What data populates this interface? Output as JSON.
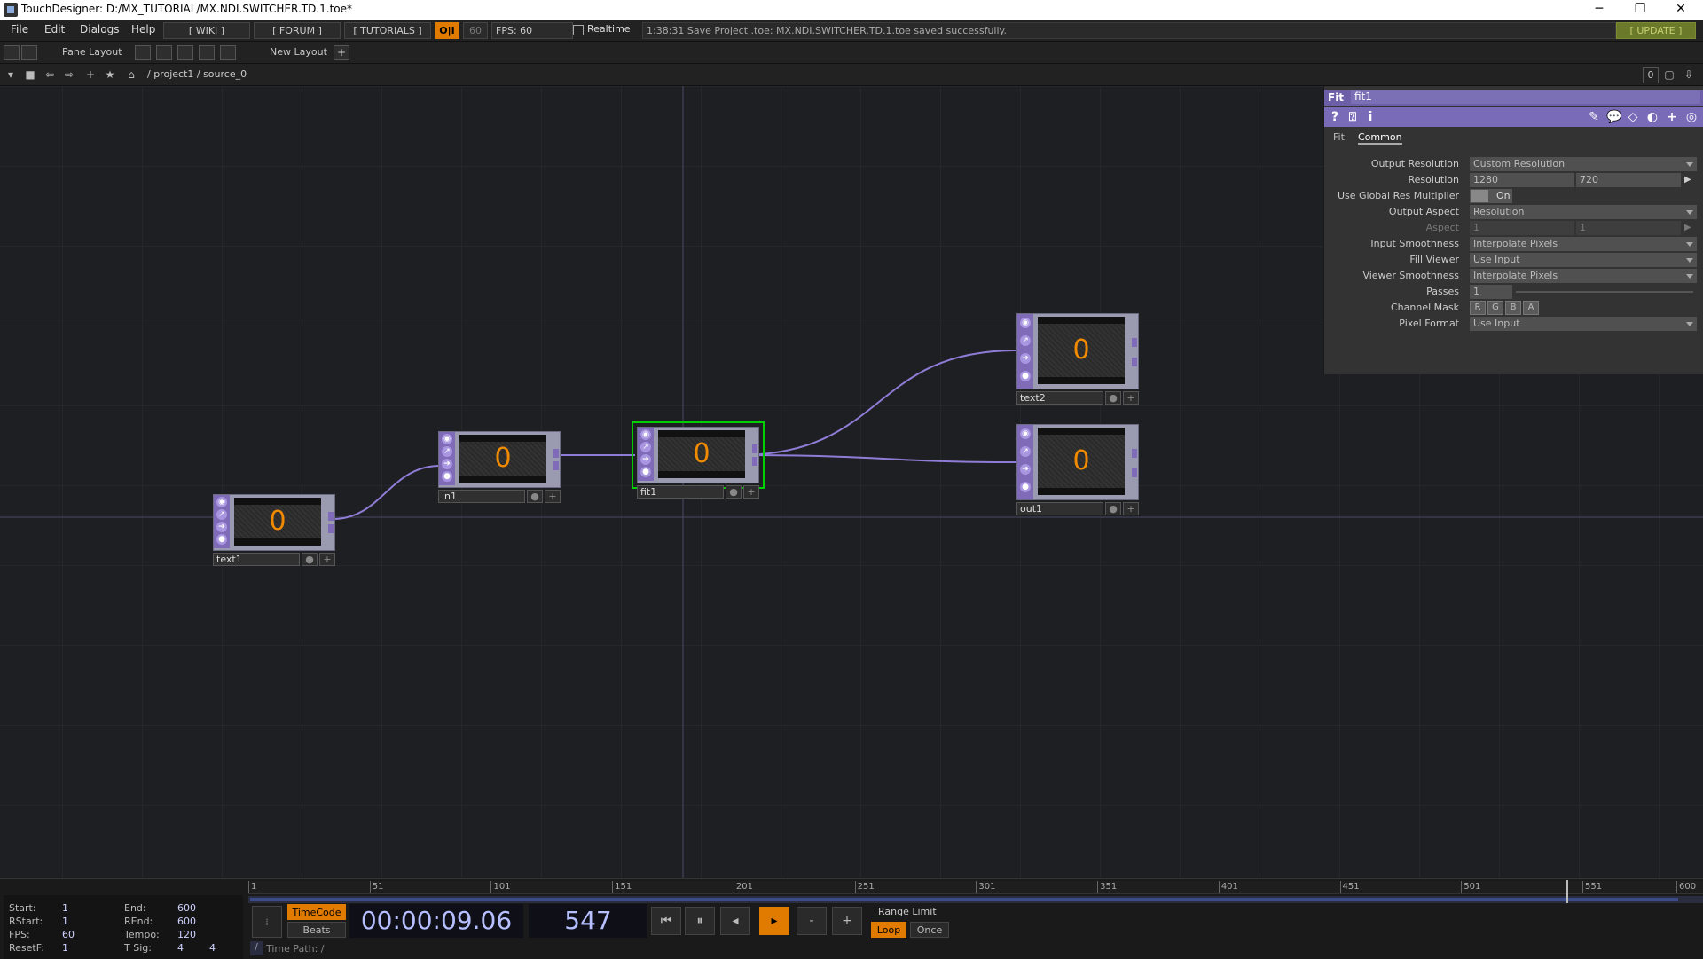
{
  "window": {
    "title": "TouchDesigner: D:/MX_TUTORIAL/MX.NDI.SWITCHER.TD.1.toe*",
    "minimize": "─",
    "restore": "❐",
    "close": "✕"
  },
  "menubar": {
    "items": [
      "File",
      "Edit",
      "Dialogs",
      "Help"
    ],
    "wiki": "[ WIKI ]",
    "forum": "[ FORUM ]",
    "tutorials": "[ TUTORIALS ]",
    "oi": "O|I",
    "fps_cap": "60",
    "fps": "FPS: 60",
    "realtime": "Realtime",
    "status": "1:38:31 Save Project .toe: MX.NDI.SWITCHER.TD.1.toe saved successfully.",
    "update": "[ UPDATE ]"
  },
  "panebar": {
    "pane_layout": "Pane Layout",
    "new_layout": "New Layout",
    "add": "+"
  },
  "pathbar": {
    "path": "/ project1 / source_0",
    "counter": "0"
  },
  "nodes": [
    {
      "name": "text1",
      "value": "0"
    },
    {
      "name": "in1",
      "value": "0"
    },
    {
      "name": "fit1",
      "value": "0"
    },
    {
      "name": "text2",
      "value": "0"
    },
    {
      "name": "out1",
      "value": "0"
    }
  ],
  "params": {
    "op_type": "Fit",
    "op_name": "fit1",
    "tabs": [
      "Fit",
      "Common"
    ],
    "rows": {
      "output_resolution": {
        "label": "Output Resolution",
        "value": "Custom Resolution"
      },
      "resolution": {
        "label": "Resolution",
        "w": "1280",
        "h": "720"
      },
      "global_res": {
        "label": "Use Global Res Multiplier",
        "value": "On"
      },
      "output_aspect": {
        "label": "Output Aspect",
        "value": "Resolution"
      },
      "aspect": {
        "label": "Aspect",
        "a": "1",
        "b": "1"
      },
      "input_smoothness": {
        "label": "Input Smoothness",
        "value": "Interpolate Pixels"
      },
      "fill_viewer": {
        "label": "Fill Viewer",
        "value": "Use Input"
      },
      "viewer_smoothness": {
        "label": "Viewer Smoothness",
        "value": "Interpolate Pixels"
      },
      "passes": {
        "label": "Passes",
        "value": "1"
      },
      "channel_mask": {
        "label": "Channel Mask",
        "channels": [
          "R",
          "G",
          "B",
          "A"
        ]
      },
      "pixel_format": {
        "label": "Pixel Format",
        "value": "Use Input"
      }
    }
  },
  "timeline": {
    "ticks": [
      "1",
      "51",
      "101",
      "151",
      "201",
      "251",
      "301",
      "351",
      "401",
      "451",
      "501",
      "551",
      "600"
    ],
    "stats": {
      "start_label": "Start:",
      "start": "1",
      "end_label": "End:",
      "end": "600",
      "rstart_label": "RStart:",
      "rstart": "1",
      "rend_label": "REnd:",
      "rend": "600",
      "fps_label": "FPS:",
      "fps": "60",
      "tempo_label": "Tempo:",
      "tempo": "120",
      "resetf_label": "ResetF:",
      "resetf": "1",
      "tsig_label": "T Sig:",
      "tsig_a": "4",
      "tsig_b": "4"
    },
    "timecode_btn": "TimeCode",
    "beats_btn": "Beats",
    "timecode": "00:00:09.06",
    "frame": "547",
    "range_limit": "Range Limit",
    "loop": "Loop",
    "once": "Once",
    "minus": "-",
    "plus": "+",
    "time_path": "Time Path: /"
  },
  "colors": {
    "accent_orange": "#f08a00",
    "op_purple": "#7f6bb8",
    "selected_green": "#00d000"
  }
}
